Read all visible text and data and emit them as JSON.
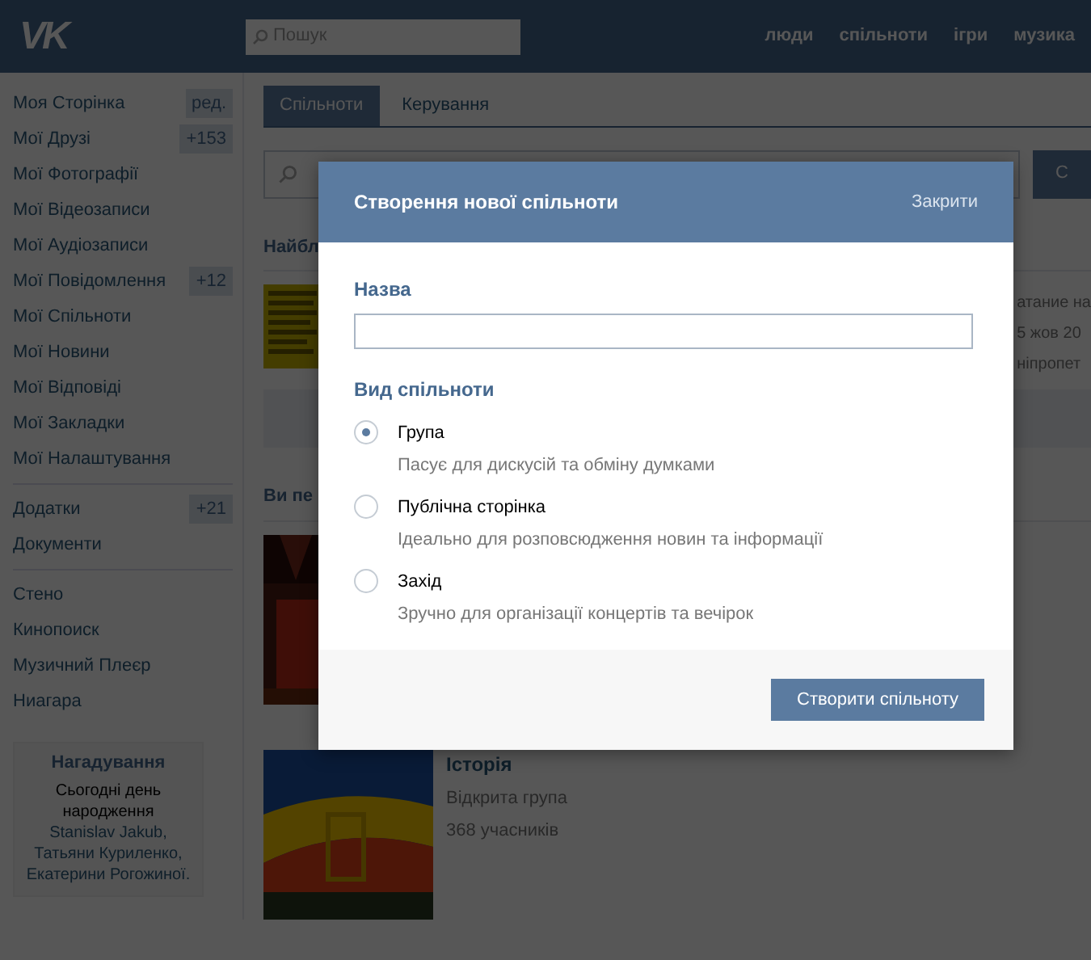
{
  "header": {
    "logo": "VK",
    "search": {
      "placeholder": "Пошук"
    },
    "nav": [
      "люди",
      "спільноти",
      "ігри",
      "музика"
    ]
  },
  "sidebar": {
    "groups": [
      [
        {
          "label": "Моя Сторінка",
          "count": "ред."
        },
        {
          "label": "Мої Друзі",
          "count": "+153"
        },
        {
          "label": "Мої Фотографії"
        },
        {
          "label": "Мої Відеозаписи"
        },
        {
          "label": "Мої Аудіозаписи"
        },
        {
          "label": "Мої Повідомлення",
          "count": "+12"
        },
        {
          "label": "Мої Спільноти"
        },
        {
          "label": "Мої Новини"
        },
        {
          "label": "Мої Відповіді"
        },
        {
          "label": "Мої Закладки"
        },
        {
          "label": "Мої Налаштування"
        }
      ],
      [
        {
          "label": "Додатки",
          "count": "+21"
        },
        {
          "label": "Документи"
        }
      ],
      [
        {
          "label": "Стено"
        },
        {
          "label": "Кинопоиск"
        },
        {
          "label": "Музичний Плеєр"
        },
        {
          "label": "Ниагара"
        }
      ]
    ],
    "reminder": {
      "title": "Нагадування",
      "text": "Сьогодні день народження",
      "links": [
        "Stanislav Jakub,",
        "Татьяни Куриленко,",
        "Екатерини Рогожиної."
      ]
    }
  },
  "main": {
    "tabs": [
      {
        "label": "Спільноти",
        "selected": true
      },
      {
        "label": "Керування",
        "selected": false
      }
    ],
    "search_button": "С",
    "section_1": {
      "heading": "Найбл",
      "lines": [
        "атание на",
        "5 жов 20",
        "ніпропет"
      ]
    },
    "section_2": {
      "heading": "Ви пе"
    },
    "group": {
      "title": "Історія",
      "type": "Відкрита група",
      "members": "368 учасників"
    }
  },
  "modal": {
    "title": "Створення нової спільноти",
    "close": "Закрити",
    "name_label": "Назва",
    "type_label": "Вид спільноти",
    "community_types": [
      {
        "label": "Група",
        "description": "Пасує для дискусій та обміну думками",
        "selected": true
      },
      {
        "label": "Публічна сторінка",
        "description": "Ідеально для розповсюдження новин та інформації",
        "selected": false
      },
      {
        "label": "Захід",
        "description": "Зручно для організації концертів та вечірок",
        "selected": false
      }
    ],
    "submit": "Створити спільноту"
  }
}
